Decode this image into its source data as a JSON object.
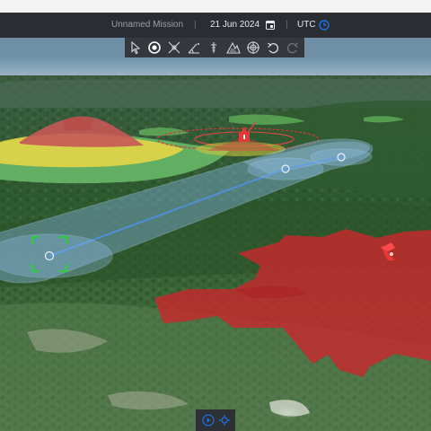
{
  "mission": {
    "title": "Unnamed Mission",
    "separator": "|",
    "date": "21 Jun 2024",
    "timezone": "UTC"
  },
  "toolbar": {
    "tools": [
      "select-arrow-icon",
      "waypoint-icon",
      "crosshair-icon",
      "measure-angle-icon",
      "antenna-icon",
      "terrain-icon",
      "target-icon",
      "undo-icon",
      "redo-icon"
    ]
  },
  "colors": {
    "accent": "#1a73e8",
    "route": "#7fb6f0",
    "threat": "#c8282c",
    "zone_red": "#c65856",
    "zone_yellow": "#e1d547",
    "zone_green": "#6bbd6b"
  },
  "bottom_controls": [
    "play-icon",
    "settings-icon"
  ]
}
